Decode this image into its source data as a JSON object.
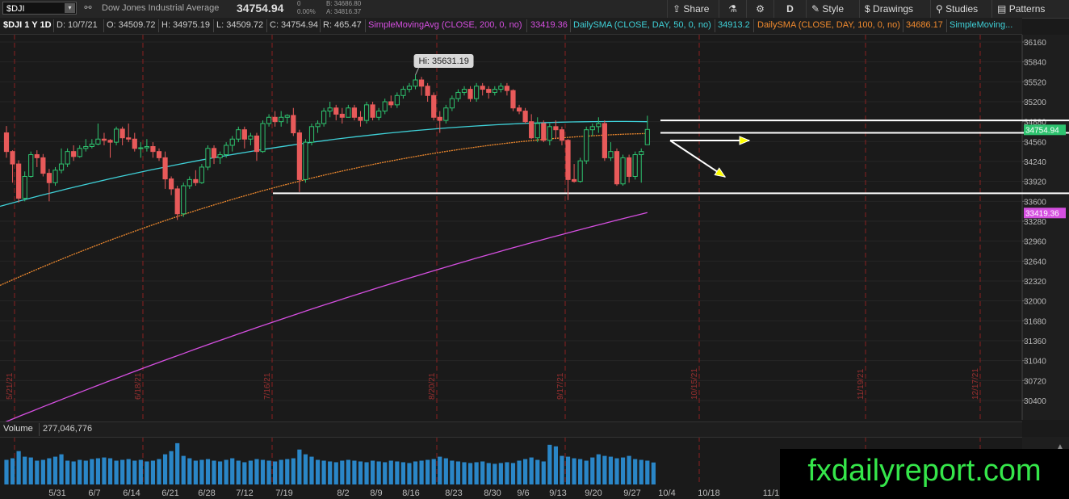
{
  "toolbar": {
    "symbol": "$DJI",
    "symbol_dropdown": "▾",
    "instrument_name": "Dow Jones Industrial Average",
    "last_price": "34754.94",
    "change": "0",
    "change_pct": "0.00%",
    "bid": "B: 34686.80",
    "ask": "A: 34816.37",
    "buttons": [
      {
        "label": "Share",
        "icon": "share-icon",
        "glyph": "⇪"
      },
      {
        "label": "",
        "icon": "flask-icon",
        "glyph": "⚗"
      },
      {
        "label": "",
        "icon": "gear-icon",
        "glyph": "⚙"
      },
      {
        "label": "D",
        "icon": "",
        "glyph": ""
      },
      {
        "label": "Style",
        "icon": "style-icon",
        "glyph": "✎"
      },
      {
        "label": "Drawings",
        "icon": "drawings-icon",
        "glyph": "$"
      },
      {
        "label": "Studies",
        "icon": "studies-icon",
        "glyph": "⚲"
      },
      {
        "label": "Patterns",
        "icon": "patterns-icon",
        "glyph": "▤"
      }
    ]
  },
  "infobar": {
    "title": "$DJI 1 Y 1D",
    "date": "D: 10/7/21",
    "open": "O: 34509.72",
    "high": "H: 34975.19",
    "low": "L: 34509.72",
    "close": "C: 34754.94",
    "range": "R: 465.47",
    "study1_label": "SimpleMovingAvg (CLOSE, 200, 0, no)",
    "study1_value": "33419.36",
    "study2_label": "DailySMA (CLOSE, DAY, 50, 0, no)",
    "study2_value": "34913.2",
    "study3_label": "DailySMA (CLOSE, DAY, 100, 0, no)",
    "study3_value": "34686.17",
    "study4_label": "SimpleMoving..."
  },
  "volume": {
    "label": "Volume",
    "value": "277,046,776"
  },
  "watermark": "fxdailyreport.com",
  "colors": {
    "up": "#2ec36f",
    "down": "#e85a5a",
    "sma50": "#3fd1d8",
    "sma100": "#f08a2e",
    "sma200": "#d54fe0",
    "volume": "#2a86c7"
  },
  "chart_data": {
    "type": "candlestick",
    "y_ticks": [
      36160,
      35840,
      35520,
      35200,
      34880,
      34560,
      34240,
      33920,
      33600,
      33280,
      32960,
      32640,
      32320,
      32000,
      31680,
      31360,
      31040,
      30720,
      30400
    ],
    "ylim": [
      30040,
      36320
    ],
    "x_tick_labels": [
      "5/31",
      "6/7",
      "6/14",
      "6/21",
      "6/28",
      "7/12",
      "7/19",
      "8/2",
      "8/9",
      "8/16",
      "8/23",
      "8/30",
      "9/6",
      "9/13",
      "9/20",
      "9/27",
      "10/4",
      "10/18",
      "11/1"
    ],
    "vertical_markers": [
      "5/21/21",
      "6/18/21",
      "7/16/21",
      "8/20/21",
      "9/17/21",
      "10/15/21",
      "11/19/21",
      "12/17/21"
    ],
    "price_labels": {
      "last": "34754.94",
      "sma200": "33419.36"
    },
    "annotation": "Hi: 35631.19",
    "horizontal_levels": [
      34900,
      34700,
      33730
    ],
    "candles": [
      {
        "date": "5/10",
        "o": 34700,
        "h": 34810,
        "l": 34300,
        "c": 34400
      },
      {
        "date": "5/11",
        "o": 34400,
        "h": 34420,
        "l": 33900,
        "c": 34200
      },
      {
        "date": "5/12",
        "o": 34200,
        "h": 34260,
        "l": 33580,
        "c": 33650
      },
      {
        "date": "5/13",
        "o": 33650,
        "h": 34080,
        "l": 33600,
        "c": 34000
      },
      {
        "date": "5/14",
        "o": 34000,
        "h": 34400,
        "l": 33980,
        "c": 34350
      },
      {
        "date": "5/17",
        "o": 34350,
        "h": 34420,
        "l": 34150,
        "c": 34300
      },
      {
        "date": "5/18",
        "o": 34300,
        "h": 34360,
        "l": 34000,
        "c": 34050
      },
      {
        "date": "5/19",
        "o": 34050,
        "h": 34120,
        "l": 33600,
        "c": 33900
      },
      {
        "date": "5/20",
        "o": 33900,
        "h": 34150,
        "l": 33850,
        "c": 34100
      },
      {
        "date": "5/21",
        "o": 34100,
        "h": 34450,
        "l": 34050,
        "c": 34200
      },
      {
        "date": "5/24",
        "o": 34200,
        "h": 34450,
        "l": 34150,
        "c": 34400
      },
      {
        "date": "5/25",
        "o": 34400,
        "h": 34500,
        "l": 34250,
        "c": 34320
      },
      {
        "date": "5/26",
        "o": 34320,
        "h": 34500,
        "l": 34300,
        "c": 34450
      },
      {
        "date": "5/27",
        "o": 34450,
        "h": 34600,
        "l": 34400,
        "c": 34480
      },
      {
        "date": "5/28",
        "o": 34480,
        "h": 34600,
        "l": 34450,
        "c": 34520
      },
      {
        "date": "6/1",
        "o": 34520,
        "h": 34850,
        "l": 34500,
        "c": 34600
      },
      {
        "date": "6/2",
        "o": 34600,
        "h": 34700,
        "l": 34500,
        "c": 34580
      },
      {
        "date": "6/3",
        "o": 34580,
        "h": 34600,
        "l": 34300,
        "c": 34550
      },
      {
        "date": "6/4",
        "o": 34550,
        "h": 34800,
        "l": 34500,
        "c": 34760
      },
      {
        "date": "6/7",
        "o": 34760,
        "h": 34800,
        "l": 34500,
        "c": 34620
      },
      {
        "date": "6/8",
        "o": 34620,
        "h": 34850,
        "l": 34550,
        "c": 34600
      },
      {
        "date": "6/9",
        "o": 34600,
        "h": 34700,
        "l": 34400,
        "c": 34450
      },
      {
        "date": "6/10",
        "o": 34450,
        "h": 34550,
        "l": 34300,
        "c": 34460
      },
      {
        "date": "6/11",
        "o": 34460,
        "h": 34600,
        "l": 34400,
        "c": 34480
      },
      {
        "date": "6/14",
        "o": 34480,
        "h": 34550,
        "l": 34300,
        "c": 34400
      },
      {
        "date": "6/15",
        "o": 34400,
        "h": 34450,
        "l": 34250,
        "c": 34300
      },
      {
        "date": "6/16",
        "o": 34300,
        "h": 34400,
        "l": 33800,
        "c": 33960
      },
      {
        "date": "6/17",
        "o": 33960,
        "h": 34000,
        "l": 33700,
        "c": 33800
      },
      {
        "date": "6/18",
        "o": 33800,
        "h": 33850,
        "l": 33300,
        "c": 33400
      },
      {
        "date": "6/21",
        "o": 33400,
        "h": 33900,
        "l": 33350,
        "c": 33850
      },
      {
        "date": "6/22",
        "o": 33850,
        "h": 34000,
        "l": 33800,
        "c": 33950
      },
      {
        "date": "6/23",
        "o": 33950,
        "h": 34100,
        "l": 33850,
        "c": 33900
      },
      {
        "date": "6/24",
        "o": 33900,
        "h": 34200,
        "l": 33880,
        "c": 34150
      },
      {
        "date": "6/25",
        "o": 34150,
        "h": 34500,
        "l": 34100,
        "c": 34450
      },
      {
        "date": "6/28",
        "o": 34450,
        "h": 34500,
        "l": 34200,
        "c": 34300
      },
      {
        "date": "6/29",
        "o": 34300,
        "h": 34400,
        "l": 34200,
        "c": 34350
      },
      {
        "date": "6/30",
        "o": 34350,
        "h": 34550,
        "l": 34300,
        "c": 34500
      },
      {
        "date": "7/1",
        "o": 34500,
        "h": 34650,
        "l": 34400,
        "c": 34600
      },
      {
        "date": "7/2",
        "o": 34600,
        "h": 34800,
        "l": 34550,
        "c": 34750
      },
      {
        "date": "7/6",
        "o": 34750,
        "h": 34800,
        "l": 34450,
        "c": 34600
      },
      {
        "date": "7/7",
        "o": 34600,
        "h": 34700,
        "l": 34500,
        "c": 34650
      },
      {
        "date": "7/8",
        "o": 34650,
        "h": 34700,
        "l": 34250,
        "c": 34400
      },
      {
        "date": "7/9",
        "o": 34400,
        "h": 34900,
        "l": 34380,
        "c": 34850
      },
      {
        "date": "7/12",
        "o": 34850,
        "h": 35000,
        "l": 34800,
        "c": 34950
      },
      {
        "date": "7/13",
        "o": 34950,
        "h": 35050,
        "l": 34800,
        "c": 34880
      },
      {
        "date": "7/14",
        "o": 34880,
        "h": 35050,
        "l": 34800,
        "c": 34950
      },
      {
        "date": "7/15",
        "o": 34950,
        "h": 35000,
        "l": 34850,
        "c": 34980
      },
      {
        "date": "7/16",
        "o": 34980,
        "h": 35100,
        "l": 34650,
        "c": 34700
      },
      {
        "date": "7/19",
        "o": 34700,
        "h": 34750,
        "l": 33750,
        "c": 33950
      },
      {
        "date": "7/20",
        "o": 33950,
        "h": 34600,
        "l": 33900,
        "c": 34550
      },
      {
        "date": "7/21",
        "o": 34550,
        "h": 34850,
        "l": 34500,
        "c": 34800
      },
      {
        "date": "7/22",
        "o": 34800,
        "h": 34900,
        "l": 34700,
        "c": 34850
      },
      {
        "date": "7/23",
        "o": 34850,
        "h": 35100,
        "l": 34800,
        "c": 35050
      },
      {
        "date": "7/26",
        "o": 35050,
        "h": 35200,
        "l": 34950,
        "c": 35100
      },
      {
        "date": "7/27",
        "o": 35100,
        "h": 35150,
        "l": 34900,
        "c": 35000
      },
      {
        "date": "7/28",
        "o": 35000,
        "h": 35100,
        "l": 34850,
        "c": 34950
      },
      {
        "date": "7/29",
        "o": 34950,
        "h": 35150,
        "l": 34950,
        "c": 35100
      },
      {
        "date": "7/30",
        "o": 35100,
        "h": 35150,
        "l": 34900,
        "c": 34950
      },
      {
        "date": "8/2",
        "o": 34950,
        "h": 35050,
        "l": 34800,
        "c": 34900
      },
      {
        "date": "8/3",
        "o": 34900,
        "h": 35200,
        "l": 34850,
        "c": 35150
      },
      {
        "date": "8/4",
        "o": 35150,
        "h": 35200,
        "l": 34900,
        "c": 34950
      },
      {
        "date": "8/5",
        "o": 34950,
        "h": 35100,
        "l": 34900,
        "c": 35050
      },
      {
        "date": "8/6",
        "o": 35050,
        "h": 35250,
        "l": 35000,
        "c": 35200
      },
      {
        "date": "8/9",
        "o": 35200,
        "h": 35300,
        "l": 35100,
        "c": 35150
      },
      {
        "date": "8/10",
        "o": 35150,
        "h": 35350,
        "l": 35100,
        "c": 35300
      },
      {
        "date": "8/11",
        "o": 35300,
        "h": 35450,
        "l": 35250,
        "c": 35400
      },
      {
        "date": "8/12",
        "o": 35400,
        "h": 35500,
        "l": 35350,
        "c": 35450
      },
      {
        "date": "8/13",
        "o": 35450,
        "h": 35631,
        "l": 35400,
        "c": 35550
      },
      {
        "date": "8/16",
        "o": 35550,
        "h": 35600,
        "l": 35300,
        "c": 35450
      },
      {
        "date": "8/17",
        "o": 35450,
        "h": 35500,
        "l": 35200,
        "c": 35300
      },
      {
        "date": "8/18",
        "o": 35300,
        "h": 35350,
        "l": 34900,
        "c": 34950
      },
      {
        "date": "8/19",
        "o": 34950,
        "h": 35050,
        "l": 34700,
        "c": 34900
      },
      {
        "date": "8/20",
        "o": 34900,
        "h": 35150,
        "l": 34850,
        "c": 35100
      },
      {
        "date": "8/23",
        "o": 35100,
        "h": 35300,
        "l": 35050,
        "c": 35250
      },
      {
        "date": "8/24",
        "o": 35250,
        "h": 35400,
        "l": 35200,
        "c": 35350
      },
      {
        "date": "8/25",
        "o": 35350,
        "h": 35450,
        "l": 35300,
        "c": 35400
      },
      {
        "date": "8/26",
        "o": 35400,
        "h": 35450,
        "l": 35200,
        "c": 35250
      },
      {
        "date": "8/27",
        "o": 35250,
        "h": 35500,
        "l": 35200,
        "c": 35450
      },
      {
        "date": "8/30",
        "o": 35450,
        "h": 35500,
        "l": 35300,
        "c": 35400
      },
      {
        "date": "8/31",
        "o": 35400,
        "h": 35450,
        "l": 35250,
        "c": 35350
      },
      {
        "date": "9/1",
        "o": 35350,
        "h": 35450,
        "l": 35300,
        "c": 35400
      },
      {
        "date": "9/2",
        "o": 35400,
        "h": 35500,
        "l": 35350,
        "c": 35450
      },
      {
        "date": "9/3",
        "o": 35450,
        "h": 35500,
        "l": 35300,
        "c": 35380
      },
      {
        "date": "9/7",
        "o": 35380,
        "h": 35400,
        "l": 35050,
        "c": 35100
      },
      {
        "date": "9/8",
        "o": 35100,
        "h": 35150,
        "l": 35000,
        "c": 35050
      },
      {
        "date": "9/9",
        "o": 35050,
        "h": 35100,
        "l": 34850,
        "c": 34880
      },
      {
        "date": "9/10",
        "o": 34880,
        "h": 35000,
        "l": 34600,
        "c": 34620
      },
      {
        "date": "9/13",
        "o": 34620,
        "h": 34950,
        "l": 34550,
        "c": 34850
      },
      {
        "date": "9/14",
        "o": 34850,
        "h": 34900,
        "l": 34550,
        "c": 34580
      },
      {
        "date": "9/15",
        "o": 34580,
        "h": 34850,
        "l": 34500,
        "c": 34800
      },
      {
        "date": "9/16",
        "o": 34800,
        "h": 34900,
        "l": 34600,
        "c": 34750
      },
      {
        "date": "9/17",
        "o": 34750,
        "h": 34800,
        "l": 34500,
        "c": 34580
      },
      {
        "date": "9/20",
        "o": 34580,
        "h": 34600,
        "l": 33620,
        "c": 33950
      },
      {
        "date": "9/21",
        "o": 33950,
        "h": 34200,
        "l": 33900,
        "c": 33920
      },
      {
        "date": "9/22",
        "o": 33920,
        "h": 34300,
        "l": 33900,
        "c": 34250
      },
      {
        "date": "9/23",
        "o": 34250,
        "h": 34800,
        "l": 34200,
        "c": 34750
      },
      {
        "date": "9/24",
        "o": 34750,
        "h": 34850,
        "l": 34650,
        "c": 34800
      },
      {
        "date": "9/27",
        "o": 34800,
        "h": 34950,
        "l": 34700,
        "c": 34850
      },
      {
        "date": "9/28",
        "o": 34850,
        "h": 34900,
        "l": 34250,
        "c": 34300
      },
      {
        "date": "9/29",
        "o": 34300,
        "h": 34550,
        "l": 34250,
        "c": 34400
      },
      {
        "date": "9/30",
        "o": 34400,
        "h": 34450,
        "l": 33850,
        "c": 33880
      },
      {
        "date": "10/1",
        "o": 33880,
        "h": 34350,
        "l": 33850,
        "c": 34300
      },
      {
        "date": "10/4",
        "o": 34300,
        "h": 34350,
        "l": 33900,
        "c": 34000
      },
      {
        "date": "10/5",
        "o": 34000,
        "h": 34400,
        "l": 33950,
        "c": 34350
      },
      {
        "date": "10/6",
        "o": 34350,
        "h": 34450,
        "l": 33900,
        "c": 34400
      },
      {
        "date": "10/7",
        "o": 34509.72,
        "h": 34975.19,
        "l": 34509.72,
        "c": 34754.94
      }
    ],
    "sma50": [
      33520,
      34880
    ],
    "sma100": [
      32250,
      34690
    ],
    "sma200": [
      30020,
      33419
    ],
    "volumes_millions": [
      310,
      330,
      420,
      350,
      340,
      300,
      310,
      330,
      350,
      380,
      300,
      290,
      310,
      300,
      320,
      330,
      340,
      330,
      300,
      310,
      320,
      300,
      310,
      290,
      300,
      320,
      380,
      420,
      520,
      360,
      330,
      300,
      310,
      320,
      300,
      290,
      310,
      330,
      300,
      280,
      300,
      320,
      310,
      300,
      290,
      310,
      320,
      330,
      440,
      380,
      350,
      310,
      300,
      290,
      280,
      300,
      310,
      300,
      290,
      280,
      300,
      290,
      280,
      300,
      290,
      280,
      270,
      290,
      300,
      310,
      320,
      350,
      330,
      300,
      290,
      280,
      270,
      280,
      290,
      270,
      260,
      270,
      280,
      270,
      300,
      320,
      340,
      310,
      290,
      500,
      480,
      360,
      350,
      330,
      320,
      300,
      340,
      380,
      360,
      350,
      330,
      340,
      360,
      320,
      310,
      300,
      277
    ]
  }
}
